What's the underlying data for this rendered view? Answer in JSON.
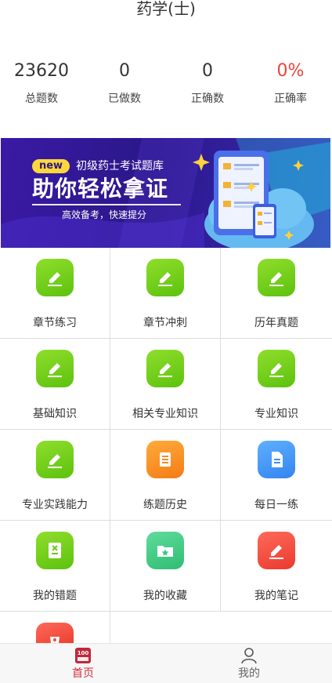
{
  "header": {
    "title": "药学(士)"
  },
  "stats": [
    {
      "value": "23620",
      "label": "总题数"
    },
    {
      "value": "0",
      "label": "已做数"
    },
    {
      "value": "0",
      "label": "正确数"
    },
    {
      "value": "0%",
      "label": "正确率"
    }
  ],
  "banner": {
    "badge": "new",
    "subtitle": "初级药士考试题库",
    "headline": "助你轻松拿证",
    "tagline": "高效备考，快速提分"
  },
  "grid": [
    {
      "label": "章节练习",
      "icon": "pencil-icon",
      "color": "#6cc91a"
    },
    {
      "label": "章节冲刺",
      "icon": "pencil-icon",
      "color": "#6cc91a"
    },
    {
      "label": "历年真题",
      "icon": "pencil-icon",
      "color": "#6cc91a"
    },
    {
      "label": "基础知识",
      "icon": "pencil-icon",
      "color": "#6cc91a"
    },
    {
      "label": "相关专业知识",
      "icon": "pencil-icon",
      "color": "#6cc91a"
    },
    {
      "label": "专业知识",
      "icon": "pencil-icon",
      "color": "#6cc91a"
    },
    {
      "label": "专业实践能力",
      "icon": "pencil-icon",
      "color": "#6cc91a"
    },
    {
      "label": "练题历史",
      "icon": "book-icon",
      "color": "#f58a22"
    },
    {
      "label": "每日一练",
      "icon": "document-icon",
      "color": "#3f8ff2"
    },
    {
      "label": "我的错题",
      "icon": "error-book-icon",
      "color": "#6cc91a"
    },
    {
      "label": "我的收藏",
      "icon": "folder-star-icon",
      "color": "#3dc47f"
    },
    {
      "label": "我的笔记",
      "icon": "note-pencil-icon",
      "color": "#ef4a3a"
    }
  ],
  "tabbar": {
    "home": {
      "label": "首页",
      "badge": "100",
      "icon": "home-100-icon",
      "color": "#d02f3a"
    },
    "mine": {
      "label": "我的",
      "icon": "person-icon"
    }
  }
}
